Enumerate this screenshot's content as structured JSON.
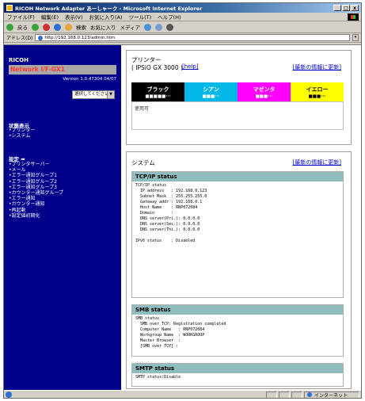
{
  "window": {
    "title": "RICOH Network Adapter あーしゃーク - Microsoft Internet Explorer",
    "controls": [
      "_",
      "□",
      "x"
    ]
  },
  "menu": [
    "ファイル(F)",
    "編集(E)",
    "表示(V)",
    "お気に入り(A)",
    "ツール(T)",
    "ヘルプ(H)"
  ],
  "toolbar": {
    "back_label": "戻る",
    "search_label": "検索",
    "favorites_label": "お気に入り",
    "media_label": "メディア"
  },
  "address": {
    "label": "アドレス(D)",
    "url": "http://192.168.0.123/admin.htm"
  },
  "sidebar": {
    "brand": "RICOH",
    "model": "Network I/F-GX1",
    "version": "Version 1.0.47304 04/07",
    "select_value": "選択してください",
    "status_heading": "状態表示",
    "status_items": [
      "•プリンター",
      "•システム"
    ],
    "settings_heading": "設定 ➡",
    "settings_items": [
      "•プリンタサーバー",
      "•メール",
      "•エラー通知グループ1",
      "•エラー通知グループ2",
      "•エラー通知グループ3",
      "•カウンター通知グループ",
      "•エラー通知",
      "•カウンター通知",
      "•再起動",
      "•設定値初期化"
    ]
  },
  "printer": {
    "title_line1": "プリンター",
    "title_line2": "( IPSiO GX 3000 )",
    "help_label": "[help]",
    "update_label": "[最新の情報に更新]",
    "toners": [
      {
        "name": "ブラック",
        "level": "■■■■■···",
        "color": "#000000"
      },
      {
        "name": "シアン",
        "level": "■■■···",
        "color": "#00b7e8"
      },
      {
        "name": "マゼンタ",
        "level": "■■■···",
        "color": "#ff00ff"
      },
      {
        "name": "イエロー",
        "level": "■■■···",
        "color": "#ffff00"
      }
    ],
    "usage_text": "使用可"
  },
  "system": {
    "title": "システム",
    "update_label": "[最新の情報に更新]",
    "tcpip": {
      "header": "TCP/IP status",
      "body": "TCP/IP status\n  IP address   : 192.168.0.123\n  Subnet Mask  : 255.255.255.0\n  Gateway addr : 192.168.0.1\n  Host Name    : RNP072084\n  Domain       :\n  DNS server(Pri.): 0.0.0.0\n  DNS server(Sec.): 0.0.0.0\n  DNS server(Thi.): 0.0.0.0\n\nIPv6 status    : Disabled"
    },
    "smb": {
      "header": "SMB status",
      "body": "SMB status\n  SMB over TCP: Registration completed\n  Computer Name   : RNP072084\n  Workgroup Name  : WORKGROUP\n  Master Browser  :\n  [SMB over TCP] :"
    },
    "smtp": {
      "header": "SMTP status",
      "body": "SMTP status:Disable"
    }
  },
  "statusbar": {
    "zone": "インターネット"
  }
}
